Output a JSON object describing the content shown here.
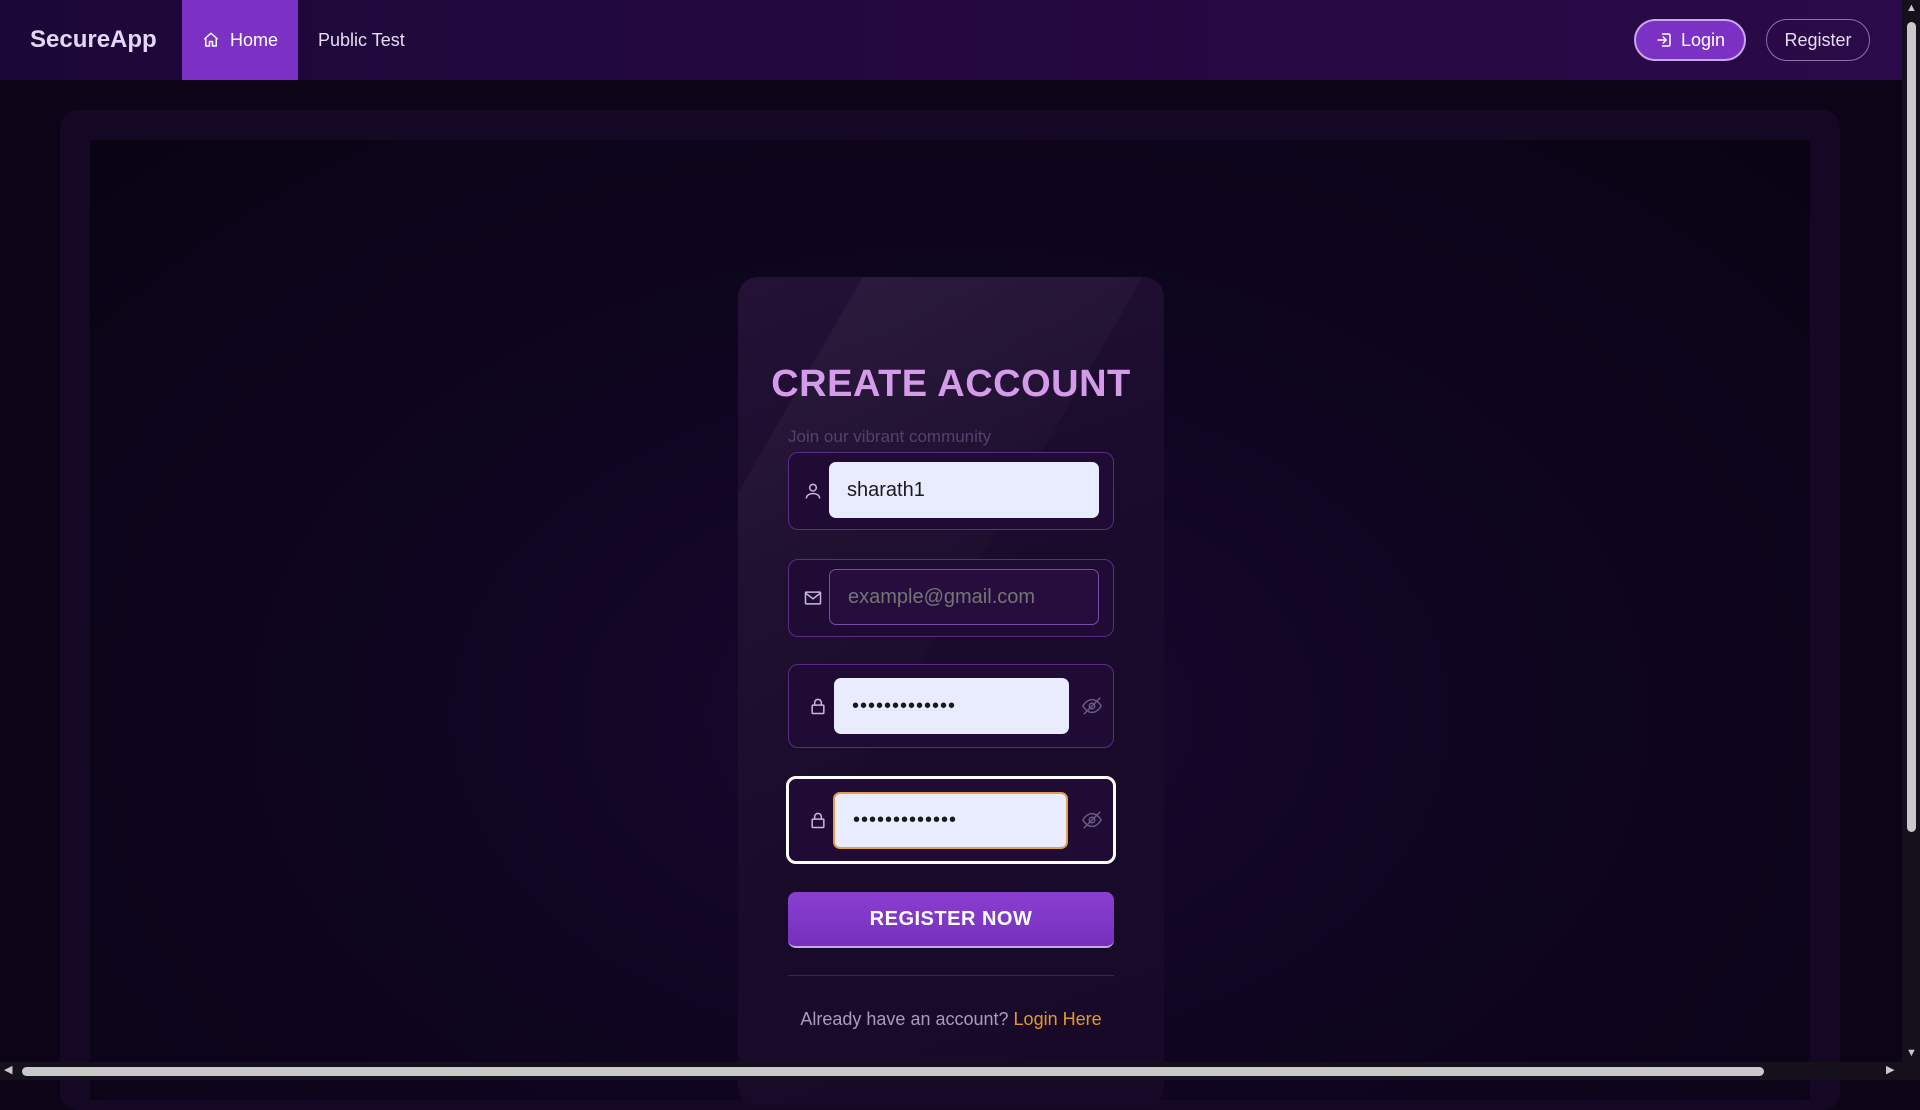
{
  "app": {
    "brand": "SecureApp"
  },
  "nav": {
    "items": [
      {
        "label": "Home",
        "icon": "home-icon",
        "active": true
      },
      {
        "label": "Public Test",
        "active": false
      }
    ],
    "login_label": "Login",
    "register_label": "Register"
  },
  "form": {
    "title": "CREATE ACCOUNT",
    "subtitle": "Join our vibrant community",
    "username": {
      "value": "sharath1",
      "icon": "user-icon"
    },
    "email": {
      "value": "",
      "placeholder": "example@gmail.com",
      "icon": "mail-icon"
    },
    "password": {
      "value": "password12345",
      "icon": "lock-icon",
      "toggle_icon": "eye-off-icon"
    },
    "confirm_password": {
      "value": "password12345",
      "icon": "lock-icon",
      "toggle_icon": "eye-off-icon",
      "focused": true
    },
    "submit_label": "REGISTER NOW",
    "footer_text": "Already have an account?",
    "footer_link": "Login Here"
  },
  "colors": {
    "accent": "#7b32c4",
    "title": "#d49be9",
    "link": "#e49a24",
    "background": "#0d0418"
  }
}
